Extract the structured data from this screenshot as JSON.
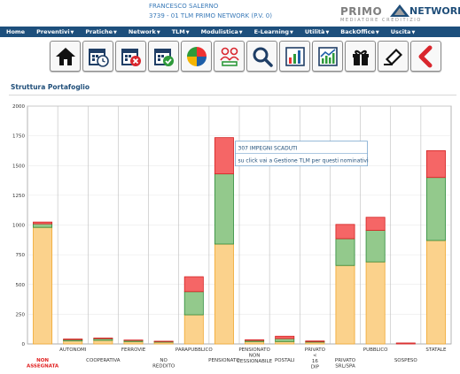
{
  "header": {
    "user_name": "FRANCESCO SALERNO",
    "user_office": "3739 - 01 TLM PRIMO NETWORK (P.V. 0)",
    "logo_primo": "PRIMO",
    "logo_network": "NETWORK",
    "logo_tagline": "MEDIATORE CREDITIZIO"
  },
  "nav": [
    {
      "label": "Home",
      "caret": false
    },
    {
      "label": "Preventivi",
      "caret": true
    },
    {
      "label": "Pratiche",
      "caret": true
    },
    {
      "label": "Network",
      "caret": true
    },
    {
      "label": "TLM",
      "caret": true
    },
    {
      "label": "Modulistica",
      "caret": true
    },
    {
      "label": "E-Learning",
      "caret": true
    },
    {
      "label": "Utilità",
      "caret": true
    },
    {
      "label": "BackOffice",
      "caret": true
    },
    {
      "label": "Uscita",
      "caret": true
    }
  ],
  "toolbar": [
    {
      "name": "home-button",
      "icon": "home-icon"
    },
    {
      "name": "calendar-clock-button",
      "icon": "calendar-clock-icon"
    },
    {
      "name": "calendar-cancel-button",
      "icon": "calendar-cancel-icon"
    },
    {
      "name": "calendar-check-button",
      "icon": "calendar-check-icon"
    },
    {
      "name": "pie-chart-button",
      "icon": "pie-chart-icon"
    },
    {
      "name": "users-button",
      "icon": "users-icon"
    },
    {
      "name": "search-button",
      "icon": "search-icon"
    },
    {
      "name": "bar-chart-button",
      "icon": "bar-chart-icon"
    },
    {
      "name": "line-chart-button",
      "icon": "line-chart-icon"
    },
    {
      "name": "gift-button",
      "icon": "gift-icon"
    },
    {
      "name": "scanner-button",
      "icon": "scanner-icon"
    },
    {
      "name": "back-button",
      "icon": "back-icon"
    }
  ],
  "section_title": "Struttura Portafoglio",
  "chart_data": {
    "type": "bar",
    "stacked": true,
    "title": "",
    "xlabel": "",
    "ylabel": "",
    "ylim": [
      0,
      2000
    ],
    "yticks": [
      0,
      250,
      500,
      750,
      1000,
      1250,
      1500,
      1750,
      2000
    ],
    "grid": true,
    "colors": {
      "fill": [
        "#fbd28c",
        "#93c98c",
        "#f56666"
      ],
      "stroke": [
        "#f0a830",
        "#2e8b3a",
        "#d42020"
      ]
    },
    "categories": [
      {
        "label": [
          "NON",
          "ASSEGNATA"
        ],
        "row": 1,
        "highlight": true
      },
      {
        "label": [
          "AUTONOMI"
        ],
        "row": 0,
        "highlight": false
      },
      {
        "label": [
          "COOPERATIVA"
        ],
        "row": 1,
        "highlight": false
      },
      {
        "label": [
          "FERROVIE"
        ],
        "row": 0,
        "highlight": false
      },
      {
        "label": [
          "NO",
          "REDDITO"
        ],
        "row": 1,
        "highlight": false
      },
      {
        "label": [
          "PARAPUBBLICO"
        ],
        "row": 0,
        "highlight": false
      },
      {
        "label": [
          "PENSIONATO"
        ],
        "row": 1,
        "highlight": false
      },
      {
        "label": [
          "PENSIONATO",
          "NON",
          "CESSIONABILE"
        ],
        "row": 0,
        "highlight": false
      },
      {
        "label": [
          "POSTALI"
        ],
        "row": 1,
        "highlight": false
      },
      {
        "label": [
          "PRIVATO",
          "<",
          "16",
          "DIP"
        ],
        "row": 0,
        "highlight": false
      },
      {
        "label": [
          "PRIVATO",
          "SRL/SPA"
        ],
        "row": 1,
        "highlight": false
      },
      {
        "label": [
          "PUBBLICO"
        ],
        "row": 0,
        "highlight": false
      },
      {
        "label": [
          "SOSPESO"
        ],
        "row": 1,
        "highlight": false
      },
      {
        "label": [
          "STATALE"
        ],
        "row": 0,
        "highlight": false
      }
    ],
    "series": [
      {
        "values": [
          980,
          25,
          30,
          20,
          15,
          245,
          840,
          20,
          20,
          15,
          660,
          690,
          0,
          870
        ]
      },
      {
        "values": [
          30,
          12,
          15,
          10,
          5,
          195,
          590,
          10,
          25,
          5,
          225,
          265,
          0,
          530
        ]
      },
      {
        "values": [
          15,
          5,
          5,
          3,
          3,
          125,
          305,
          5,
          20,
          5,
          120,
          110,
          8,
          225
        ]
      }
    ],
    "tooltip": {
      "bar_index": 6,
      "line1": "307 IMPEGNI SCADUTI",
      "line2": "su click vai a Gestione TLM per questi nominativi"
    }
  }
}
